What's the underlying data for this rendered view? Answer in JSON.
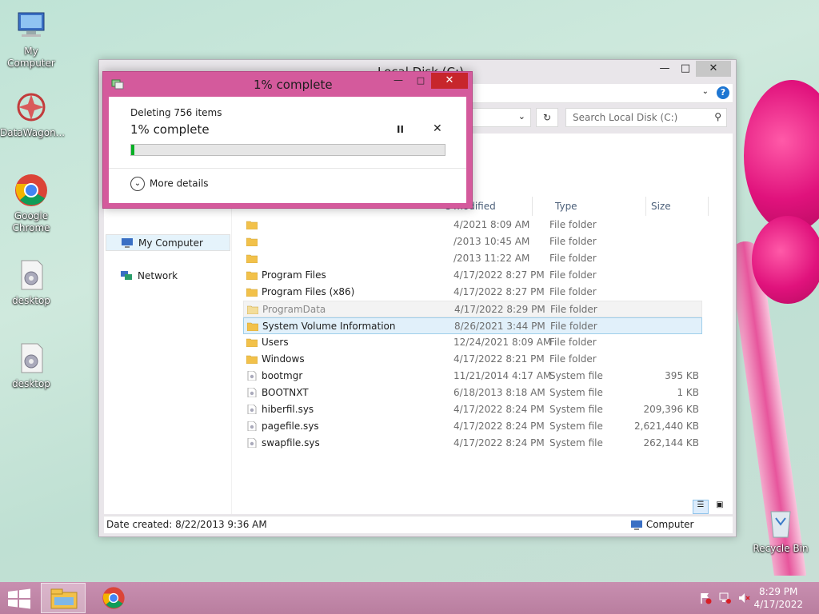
{
  "desktop": {
    "icons": [
      {
        "label": "My Computer",
        "icon": "computer-icon"
      },
      {
        "label": "DataWagon...",
        "icon": "datawagon-icon"
      },
      {
        "label": "Google Chrome",
        "icon": "chrome-icon"
      },
      {
        "label": "desktop",
        "icon": "settings-file-icon"
      },
      {
        "label": "desktop",
        "icon": "settings-file-icon"
      }
    ],
    "recycle_bin": "Recycle Bin"
  },
  "explorer": {
    "title": "Local Disk (C:)",
    "search_placeholder": "Search Local Disk (C:)",
    "columns": [
      "e modified",
      "Type",
      "Size"
    ],
    "nav": [
      {
        "label": "My Computer",
        "icon": "computer-icon",
        "selected": true
      },
      {
        "label": "Network",
        "icon": "network-icon",
        "selected": false
      }
    ],
    "rows": [
      {
        "name": "",
        "date": "4/2021 8:09 AM",
        "type": "File folder",
        "size": "",
        "kind": "folder"
      },
      {
        "name": "",
        "date": "/2013 10:45 AM",
        "type": "File folder",
        "size": "",
        "kind": "folder"
      },
      {
        "name": "",
        "date": "/2013 11:22 AM",
        "type": "File folder",
        "size": "",
        "kind": "folder"
      },
      {
        "name": "Program Files",
        "date": "4/17/2022 8:27 PM",
        "type": "File folder",
        "size": "",
        "kind": "folder"
      },
      {
        "name": "Program Files (x86)",
        "date": "4/17/2022 8:27 PM",
        "type": "File folder",
        "size": "",
        "kind": "folder"
      },
      {
        "name": "ProgramData",
        "date": "4/17/2022 8:29 PM",
        "type": "File folder",
        "size": "",
        "kind": "folder",
        "state": "hover"
      },
      {
        "name": "System Volume Information",
        "date": "8/26/2021 3:44 PM",
        "type": "File folder",
        "size": "",
        "kind": "folder",
        "state": "sel"
      },
      {
        "name": "Users",
        "date": "12/24/2021 8:09 AM",
        "type": "File folder",
        "size": "",
        "kind": "folder"
      },
      {
        "name": "Windows",
        "date": "4/17/2022 8:21 PM",
        "type": "File folder",
        "size": "",
        "kind": "folder"
      },
      {
        "name": "bootmgr",
        "date": "11/21/2014 4:17 AM",
        "type": "System file",
        "size": "395 KB",
        "kind": "file"
      },
      {
        "name": "BOOTNXT",
        "date": "6/18/2013 8:18 AM",
        "type": "System file",
        "size": "1 KB",
        "kind": "file"
      },
      {
        "name": "hiberfil.sys",
        "date": "4/17/2022 8:24 PM",
        "type": "System file",
        "size": "209,396 KB",
        "kind": "file"
      },
      {
        "name": "pagefile.sys",
        "date": "4/17/2022 8:24 PM",
        "type": "System file",
        "size": "2,621,440 KB",
        "kind": "file"
      },
      {
        "name": "swapfile.sys",
        "date": "4/17/2022 8:24 PM",
        "type": "System file",
        "size": "262,144 KB",
        "kind": "file"
      }
    ],
    "status_left": "Date created: 8/22/2013 9:36 AM",
    "status_right": "Computer"
  },
  "dialog": {
    "title": "1% complete",
    "subtitle": "Deleting 756 items",
    "main": "1% complete",
    "progress": 0.01,
    "pause_label": "II",
    "cancel_label": "✕",
    "more_details": "More details"
  },
  "taskbar": {
    "time": "8:29 PM",
    "date": "4/17/2022"
  },
  "colors": {
    "dialog_frame": "#d45a9c",
    "progress_fill": "#06b025",
    "close_red": "#c7262c",
    "taskbar": "#c88fb0"
  }
}
